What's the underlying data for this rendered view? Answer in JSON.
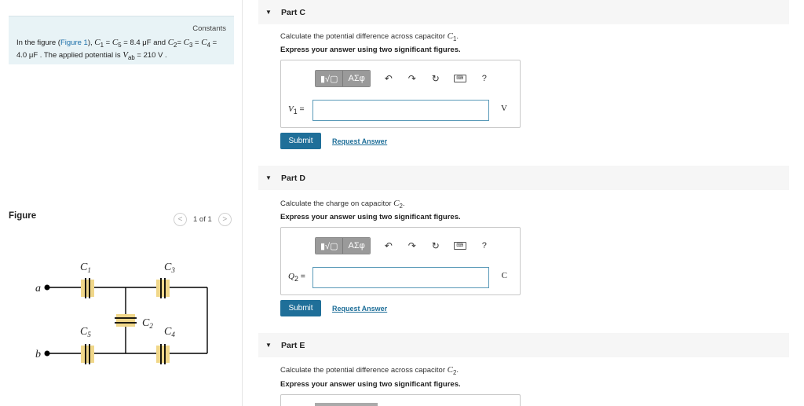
{
  "constants": {
    "title": "Constants",
    "text_prefix": "In the figure (",
    "figure_link": "Figure 1",
    "text_after_link": "), ",
    "c1": "C",
    "c1_sub": "1",
    "eq1": " = ",
    "c5": "C",
    "c5_sub": "5",
    "val1": " = 8.4 μF and ",
    "c2": "C",
    "c2_sub": "2",
    "eq2": "= ",
    "c3": "C",
    "c3_sub": "3",
    "eq3": " = ",
    "c4": "C",
    "c4_sub": "4",
    "val2": " = 4.0 μF . The applied potential is ",
    "vab": "V",
    "vab_sub": "ab",
    "val3": " = 210 V ."
  },
  "figure": {
    "label": "Figure",
    "prev": "<",
    "next": ">",
    "page": "1 of 1",
    "labels": {
      "c1": "C",
      "c1_sub": "1",
      "c3": "C",
      "c3_sub": "3",
      "c2": "C",
      "c2_sub": "2",
      "c5": "C",
      "c5_sub": "5",
      "c4": "C",
      "c4_sub": "4",
      "a": "a",
      "b": "b"
    }
  },
  "toolbar": {
    "templates": "▮√▢",
    "greek": "ΑΣφ",
    "undo": "↶",
    "redo": "↷",
    "reset": "↻",
    "keyboard": "⌨",
    "help": "?"
  },
  "partC": {
    "arrow": "▼",
    "title": "Part C",
    "question": "Calculate the potential difference across capacitor ",
    "q_var": "C",
    "q_sub": "1",
    "q_end": ".",
    "instruction": "Express your answer using two significant figures.",
    "var": "V",
    "var_sub": "1",
    "var_eq": " =",
    "input_value": "",
    "unit": "V",
    "submit": "Submit",
    "request": "Request Answer"
  },
  "partD": {
    "arrow": "▼",
    "title": "Part D",
    "question": "Calculate the charge on capacitor ",
    "q_var": "C",
    "q_sub": "2",
    "q_end": ".",
    "instruction": "Express your answer using two significant figures.",
    "var": "Q",
    "var_sub": "2",
    "var_eq": " =",
    "input_value": "",
    "unit": "C",
    "submit": "Submit",
    "request": "Request Answer"
  },
  "partE": {
    "arrow": "▼",
    "title": "Part E",
    "question": "Calculate the potential difference across capacitor ",
    "q_var": "C",
    "q_sub": "2",
    "q_end": ".",
    "instruction": "Express your answer using two significant figures."
  }
}
